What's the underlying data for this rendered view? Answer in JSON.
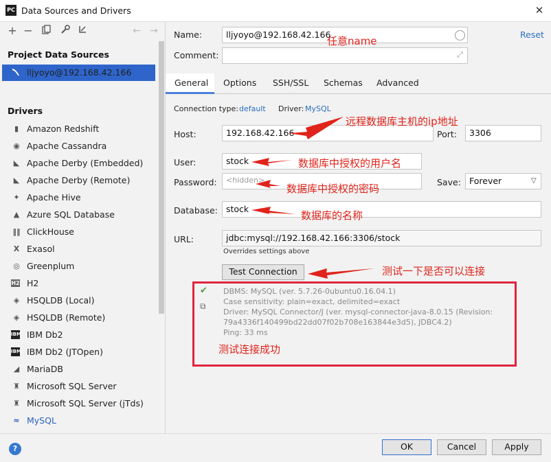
{
  "window": {
    "title": "Data Sources and Drivers",
    "app_icon_text": "PC"
  },
  "toolbar": {
    "add": "+",
    "remove": "−"
  },
  "project": {
    "section_title": "Project Data Sources",
    "items": [
      {
        "label": "lljyoyo@192.168.42.166"
      }
    ]
  },
  "drivers": {
    "section_title": "Drivers",
    "items": [
      {
        "label": "Amazon Redshift",
        "icon": "db-cylinder-icon"
      },
      {
        "label": "Apache Cassandra",
        "icon": "eye-icon"
      },
      {
        "label": "Apache Derby (Embedded)",
        "icon": "hat-icon"
      },
      {
        "label": "Apache Derby (Remote)",
        "icon": "hat-icon"
      },
      {
        "label": "Apache Hive",
        "icon": "bee-icon"
      },
      {
        "label": "Azure SQL Database",
        "icon": "azure-icon"
      },
      {
        "label": "ClickHouse",
        "icon": "bars-icon"
      },
      {
        "label": "Exasol",
        "icon": "x-icon"
      },
      {
        "label": "Greenplum",
        "icon": "greenplum-icon"
      },
      {
        "label": "H2",
        "icon": "h2-icon"
      },
      {
        "label": "HSQLDB (Local)",
        "icon": "hsqldb-icon"
      },
      {
        "label": "HSQLDB (Remote)",
        "icon": "hsqldb-icon"
      },
      {
        "label": "IBM Db2",
        "icon": "ibm-icon"
      },
      {
        "label": "IBM Db2 (JTOpen)",
        "icon": "ibm-icon"
      },
      {
        "label": "MariaDB",
        "icon": "seal-icon"
      },
      {
        "label": "Microsoft SQL Server",
        "icon": "sqlserver-icon"
      },
      {
        "label": "Microsoft SQL Server (jTds)",
        "icon": "sqlserver-icon"
      },
      {
        "label": "MySQL",
        "icon": "dolphin-icon"
      }
    ],
    "active": "MySQL"
  },
  "form": {
    "name_label": "Name:",
    "name_value": "lljyoyo@192.168.42.166",
    "comment_label": "Comment:",
    "comment_value": "",
    "reset": "Reset",
    "tabs": [
      "General",
      "Options",
      "SSH/SSL",
      "Schemas",
      "Advanced"
    ],
    "active_tab": "General",
    "connection_type_label": "Connection type:",
    "connection_type_value": "default",
    "driver_label": "Driver:",
    "driver_value": "MySQL",
    "host_label": "Host:",
    "host_value": "192.168.42.166",
    "port_label": "Port:",
    "port_value": "3306",
    "user_label": "User:",
    "user_value": "stock",
    "password_label": "Password:",
    "password_placeholder": "<hidden>",
    "save_label": "Save:",
    "save_value": "Forever",
    "database_label": "Database:",
    "database_value": "stock",
    "url_label": "URL:",
    "url_value": "jdbc:mysql://192.168.42.166:3306/stock",
    "url_note": "Overrides settings above",
    "test_button": "Test Connection"
  },
  "test_result": {
    "lines": [
      "DBMS: MySQL (ver. 5.7.26-0ubuntu0.16.04.1)",
      "Case sensitivity: plain=exact, delimited=exact",
      "Driver: MySQL Connector/J (ver. mysql-connector-java-8.0.15 (Revision:",
      "79a4336f140499bd22dd07f02b708e163844e3d5), JDBC4.2)",
      "Ping: 33 ms"
    ]
  },
  "annotations": {
    "name": "任意name",
    "host": "远程数据库主机的ip地址",
    "user": "数据库中授权的用户名",
    "password": "数据库中授权的密码",
    "database": "数据库的名称",
    "test": "测试一下是否可以连接",
    "success": "测试连接成功"
  },
  "buttons": {
    "ok": "OK",
    "cancel": "Cancel",
    "apply": "Apply",
    "help": "?"
  },
  "colors": {
    "accent": "#2f65ca",
    "link": "#2a6ebf",
    "annotation": "#e0241b"
  }
}
